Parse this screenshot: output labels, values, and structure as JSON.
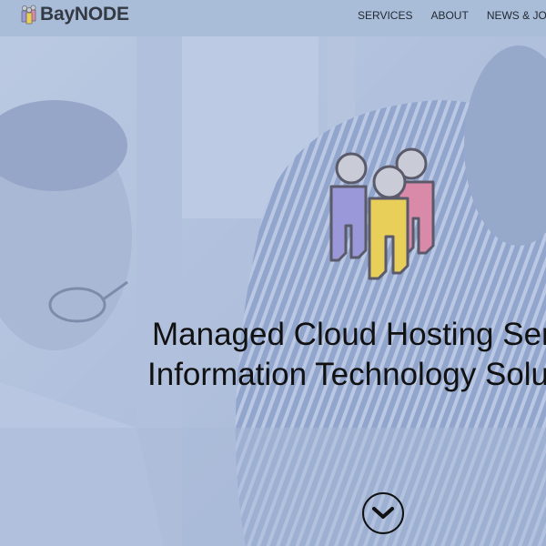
{
  "brand": {
    "name": "BayNODE",
    "logo_icon": "people-group-icon"
  },
  "nav": {
    "items": [
      {
        "label": "SERVICES"
      },
      {
        "label": "ABOUT"
      },
      {
        "label": "NEWS & JOURNAL"
      }
    ]
  },
  "hero": {
    "icon": "people-group-icon",
    "headline_line1": "Managed Cloud Hosting Services",
    "headline_line2": "Information Technology Solutions",
    "scroll_icon": "chevron-down-icon"
  },
  "colors": {
    "overlay": "#aebfd8",
    "figure_purple": "#9a98d8",
    "figure_yellow": "#e8cf5a",
    "figure_pink": "#d98aa8",
    "text": "#111111"
  }
}
